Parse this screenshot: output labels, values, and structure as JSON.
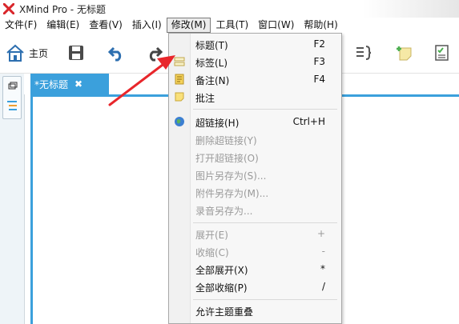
{
  "window": {
    "title": "XMind Pro - 无标题"
  },
  "menubar": {
    "items": [
      "文件(F)",
      "编辑(E)",
      "查看(V)",
      "插入(I)",
      "修改(M)",
      "工具(T)",
      "窗口(W)",
      "帮助(H)"
    ],
    "active_index": 4
  },
  "toolbar": {
    "home_label": "主页"
  },
  "editor": {
    "tab_label": "*无标题",
    "tab_close": "✖"
  },
  "dropdown": {
    "items": [
      {
        "label": "标题(T)",
        "key": "F2",
        "enabled": true,
        "icon": "topic-icon"
      },
      {
        "label": "标签(L)",
        "key": "F3",
        "enabled": true,
        "icon": "label-icon"
      },
      {
        "label": "备注(N)",
        "key": "F4",
        "enabled": true,
        "icon": "notes-icon"
      },
      {
        "label": "批注",
        "key": "",
        "enabled": true,
        "icon": "comment-icon"
      },
      {
        "label": "超链接(H)",
        "key": "Ctrl+H",
        "enabled": true,
        "icon": "hyperlink-globe-icon"
      },
      {
        "label": "删除超链接(Y)",
        "key": "",
        "enabled": false,
        "icon": ""
      },
      {
        "label": "打开超链接(O)",
        "key": "",
        "enabled": false,
        "icon": ""
      },
      {
        "label": "图片另存为(S)...",
        "key": "",
        "enabled": false,
        "icon": ""
      },
      {
        "label": "附件另存为(M)...",
        "key": "",
        "enabled": false,
        "icon": ""
      },
      {
        "label": "录音另存为...",
        "key": "",
        "enabled": false,
        "icon": ""
      },
      {
        "label": "展开(E)",
        "key": "+",
        "enabled": false,
        "icon": ""
      },
      {
        "label": "收缩(C)",
        "key": "-",
        "enabled": false,
        "icon": ""
      },
      {
        "label": "全部展开(X)",
        "key": "*",
        "enabled": true,
        "icon": ""
      },
      {
        "label": "全部收缩(P)",
        "key": "/",
        "enabled": true,
        "icon": ""
      },
      {
        "label": "允许主题重叠",
        "key": "",
        "enabled": true,
        "icon": ""
      }
    ]
  },
  "colors": {
    "accent": "#3ba0dc",
    "annotation_arrow": "#e8262b",
    "logo": "#d9262b"
  }
}
